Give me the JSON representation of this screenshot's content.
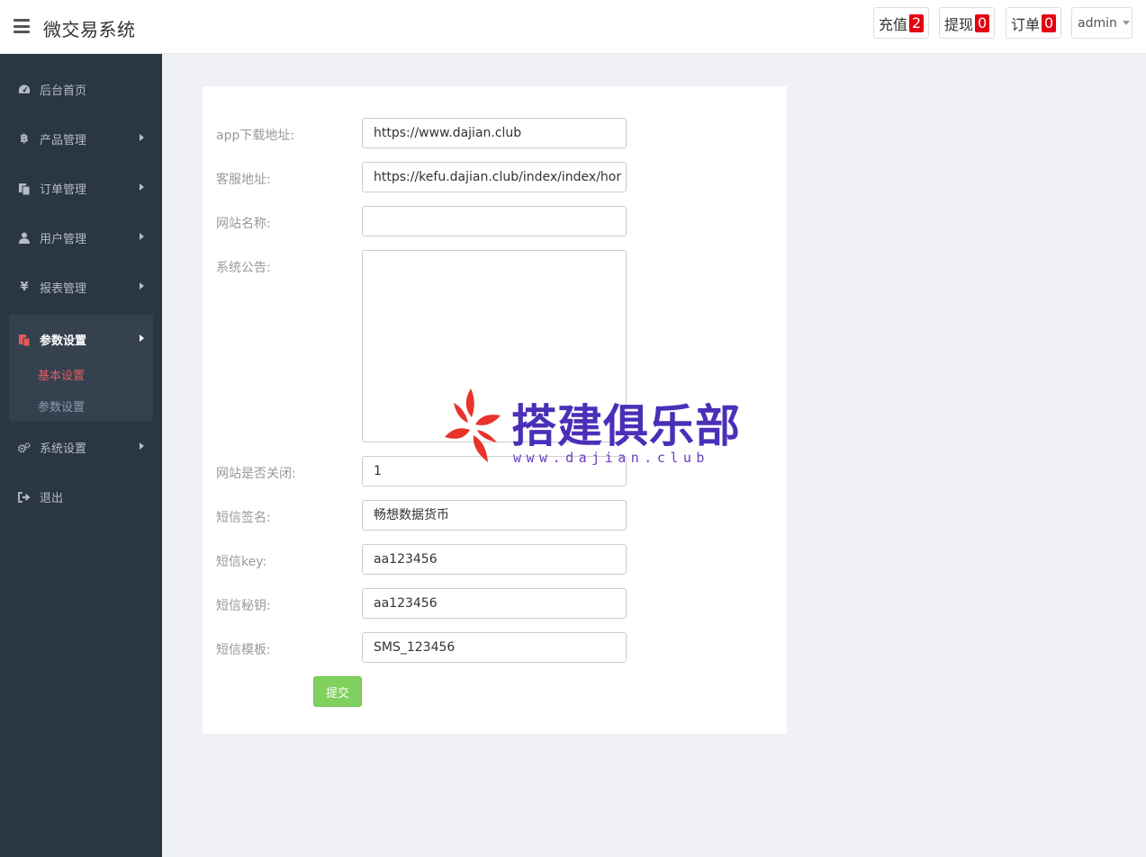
{
  "header": {
    "title": "微交易系统",
    "recharge": {
      "label": "充值",
      "count": "2"
    },
    "withdraw": {
      "label": "提现",
      "count": "0"
    },
    "orders": {
      "label": "订单",
      "count": "0"
    },
    "user": "admin"
  },
  "sidebar": {
    "items": [
      {
        "label": "后台首页",
        "icon": "dashboard-icon"
      },
      {
        "label": "产品管理",
        "icon": "bitcoin-icon"
      },
      {
        "label": "订单管理",
        "icon": "copy-icon"
      },
      {
        "label": "用户管理",
        "icon": "user-icon"
      },
      {
        "label": "报表管理",
        "icon": "yen-icon"
      },
      {
        "label": "参数设置",
        "icon": "paste-icon"
      },
      {
        "label": "系统设置",
        "icon": "cogs-icon"
      },
      {
        "label": "退出",
        "icon": "sign-out-icon"
      }
    ],
    "subitems": [
      {
        "label": "基本设置"
      },
      {
        "label": "参数设置"
      }
    ]
  },
  "form": {
    "fields": [
      {
        "label": "app下载地址:",
        "value": "https://www.dajian.club"
      },
      {
        "label": "客服地址:",
        "value": "https://kefu.dajian.club/index/index/hor"
      },
      {
        "label": "网站名称:",
        "value": ""
      },
      {
        "label": "系统公告:",
        "value": ""
      },
      {
        "label": "网站是否关闭:",
        "value": "1"
      },
      {
        "label": "短信签名:",
        "value": "畅想数据货币"
      },
      {
        "label": "短信key:",
        "value": "aa123456"
      },
      {
        "label": "短信秘钥:",
        "value": "aa123456"
      },
      {
        "label": "短信模板:",
        "value": "SMS_123456"
      }
    ],
    "submit_label": "提交"
  },
  "watermark": {
    "text": "搭建俱乐部",
    "url": "www.dajian.club"
  },
  "colors": {
    "sidebar_bg": "#2b3643",
    "accent": "#e35b5a",
    "badge": "#e60012",
    "submit": "#80d05e"
  }
}
